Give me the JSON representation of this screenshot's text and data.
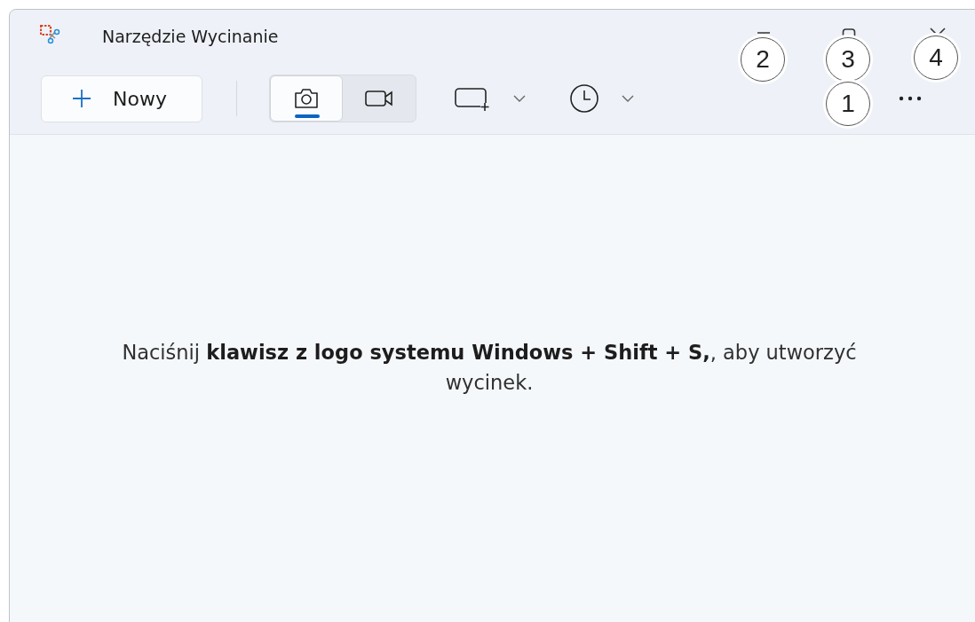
{
  "window": {
    "title": "Narzędzie Wycinanie"
  },
  "toolbar": {
    "new_button": {
      "label": "Nowy"
    },
    "capture_modes": [
      {
        "kind": "screenshot",
        "selected": true
      },
      {
        "kind": "video",
        "selected": false
      }
    ],
    "dropdowns": [
      {
        "kind": "shape"
      },
      {
        "kind": "timer"
      }
    ]
  },
  "content": {
    "message": "Naciśnij **klawisz z logo systemu Windows + Shift + S,**, aby utworzyć wycinek."
  },
  "callouts": [
    {
      "label": "2"
    },
    {
      "label": "3"
    },
    {
      "label": "4"
    },
    {
      "label": "1"
    }
  ]
}
